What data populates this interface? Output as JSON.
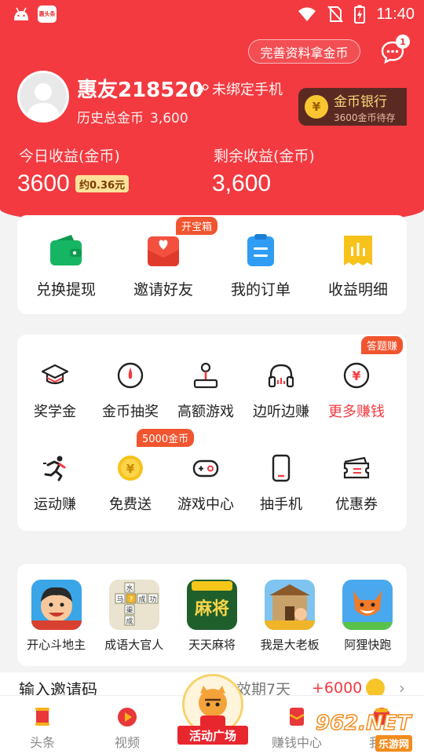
{
  "status_bar": {
    "app_badge": "惠头条",
    "time": "11:40"
  },
  "header": {
    "profile_pill": "完善资料拿金币",
    "message_badge": "1",
    "username": "惠友218520",
    "bind_phone": "未绑定手机",
    "history_label": "历史总金币",
    "history_value": "3,600",
    "coin_bank": {
      "icon": "¥",
      "title": "金币银行",
      "subtitle": "3600金币待存"
    },
    "today_label": "今日收益(金币)",
    "today_value": "3600",
    "today_approx": "约0.36元",
    "remaining_label": "剩余收益(金币)",
    "remaining_value": "3,600",
    "accent_color": "#f23a40"
  },
  "quick_actions": [
    {
      "label": "兑换提现",
      "icon": "wallet-icon"
    },
    {
      "label": "邀请好友",
      "icon": "envelope-heart-icon",
      "ribbon": "开宝箱"
    },
    {
      "label": "我的订单",
      "icon": "clipboard-icon"
    },
    {
      "label": "收益明细",
      "icon": "receipt-icon"
    }
  ],
  "earn_grid": [
    {
      "label": "奖学金",
      "icon": "graduation-cap-icon"
    },
    {
      "label": "金币抽奖",
      "icon": "lottery-dial-icon"
    },
    {
      "label": "高额游戏",
      "icon": "joystick-icon"
    },
    {
      "label": "边听边赚",
      "icon": "headphones-icon"
    },
    {
      "label": "更多赚钱",
      "icon": "yen-circle-icon",
      "ribbon": "答题赚",
      "highlight": true
    },
    {
      "label": "运动赚",
      "icon": "running-icon"
    },
    {
      "label": "免费送",
      "icon": "coin-icon",
      "ribbon": "5000金币"
    },
    {
      "label": "游戏中心",
      "icon": "gamepad-icon"
    },
    {
      "label": "抽手机",
      "icon": "phone-icon"
    },
    {
      "label": "优惠券",
      "icon": "coupon-icon"
    }
  ],
  "games": [
    {
      "name": "开心斗地主",
      "icon": "doudizhu-icon"
    },
    {
      "name": "成语大官人",
      "icon": "idiom-icon",
      "icon_chars": [
        "水",
        "马",
        "?",
        "成",
        "功",
        "渠",
        "成"
      ]
    },
    {
      "name": "天天麻将",
      "icon": "mahjong-icon",
      "icon_text": "麻将"
    },
    {
      "name": "我是大老板",
      "icon": "boss-icon"
    },
    {
      "name": "阿狸快跑",
      "icon": "fox-run-icon"
    }
  ],
  "invite": {
    "title": "输入邀请码",
    "note": "奖励有效期7天",
    "bonus": "+6000",
    "chevron": "›"
  },
  "tabbar": [
    {
      "label": "头条",
      "icon": "news-tab-icon"
    },
    {
      "label": "视频",
      "icon": "video-tab-icon"
    },
    {
      "label": "活动广场",
      "icon": "activity-tab-icon",
      "center": true
    },
    {
      "label": "赚钱中心",
      "icon": "earn-tab-icon"
    },
    {
      "label": "我的",
      "icon": "me-tab-icon"
    }
  ],
  "watermark": {
    "number": "962.NET",
    "text": "乐游网"
  }
}
